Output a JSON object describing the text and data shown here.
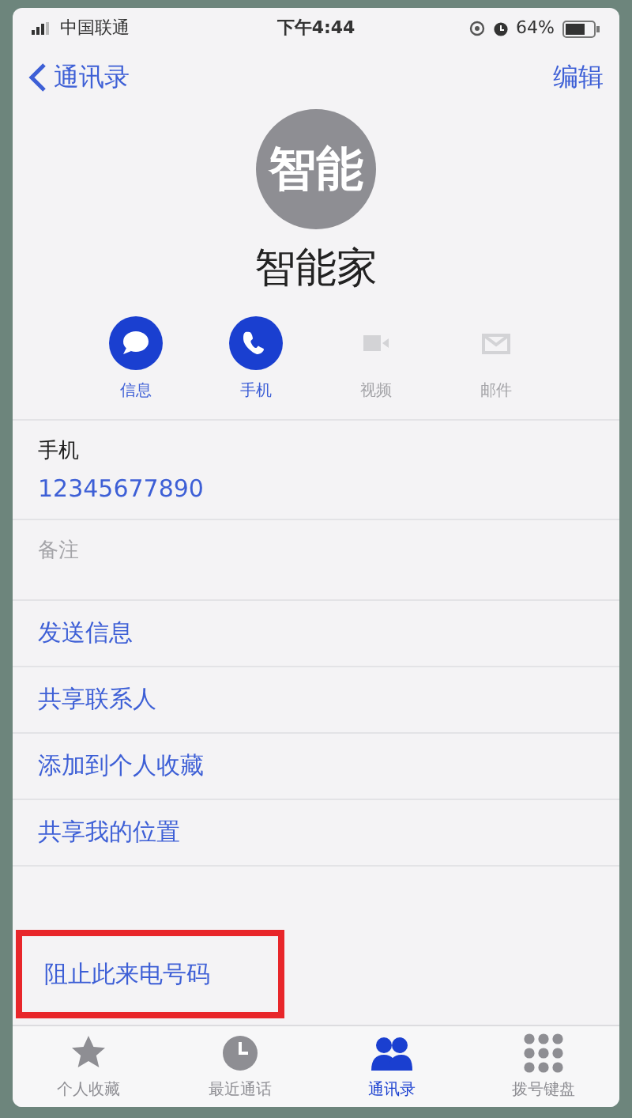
{
  "status_bar": {
    "carrier": "中国联通",
    "time": "下午4:44",
    "battery": "64%"
  },
  "nav": {
    "back": "通讯录",
    "edit": "编辑"
  },
  "contact": {
    "avatar": "智能",
    "name": "智能家"
  },
  "actions": [
    {
      "label": "信息",
      "kind": "message",
      "disabled": false
    },
    {
      "label": "手机",
      "kind": "call",
      "disabled": false
    },
    {
      "label": "视频",
      "kind": "video",
      "disabled": true
    },
    {
      "label": "邮件",
      "kind": "mail",
      "disabled": true
    }
  ],
  "phone": {
    "label": "手机",
    "value": "12345677890"
  },
  "notes": {
    "placeholder": "备注"
  },
  "menu": [
    {
      "label": "发送信息",
      "highlighted": false
    },
    {
      "label": "共享联系人",
      "highlighted": false
    },
    {
      "label": "添加到个人收藏",
      "highlighted": false
    },
    {
      "label": "共享我的位置",
      "highlighted": false
    }
  ],
  "block": {
    "label": "阻止此来电号码",
    "highlighted": true
  },
  "tab_bar": [
    {
      "label": "个人收藏",
      "kind": "star",
      "selected": false
    },
    {
      "label": "最近通话",
      "kind": "clock",
      "selected": false
    },
    {
      "label": "通讯录",
      "kind": "people",
      "selected": true
    },
    {
      "label": "拨号键盘",
      "kind": "keypad",
      "selected": false
    }
  ]
}
